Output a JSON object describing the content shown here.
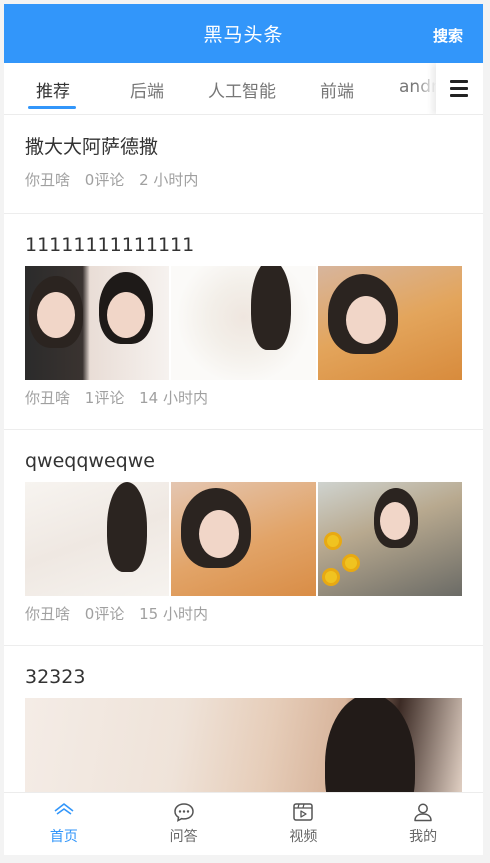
{
  "header": {
    "title": "黑马头条",
    "search_label": "搜索"
  },
  "channels": {
    "items": [
      {
        "label": "推荐"
      },
      {
        "label": "后端"
      },
      {
        "label": "人工智能"
      },
      {
        "label": "前端"
      },
      {
        "label": "andr"
      }
    ],
    "active_index": 0,
    "menu_icon": "hamburger-menu-icon"
  },
  "articles": [
    {
      "title": "撒大大阿萨德撒",
      "author": "你丑啥",
      "comments": "0评论",
      "time": "2 小时内",
      "images": 0
    },
    {
      "title": "11111111111111",
      "author": "你丑啥",
      "comments": "1评论",
      "time": "14 小时内",
      "images": 3
    },
    {
      "title": "qweqqweqwe",
      "author": "你丑啥",
      "comments": "0评论",
      "time": "15 小时内",
      "images": 3
    },
    {
      "title": "32323",
      "images": 1
    }
  ],
  "tabbar": {
    "items": [
      {
        "label": "首页",
        "icon": "home-icon"
      },
      {
        "label": "问答",
        "icon": "chat-bubble-icon"
      },
      {
        "label": "视频",
        "icon": "video-icon"
      },
      {
        "label": "我的",
        "icon": "user-icon"
      }
    ],
    "active_index": 0
  },
  "colors": {
    "primary": "#3296fa",
    "meta_text": "#a0a0a0"
  }
}
